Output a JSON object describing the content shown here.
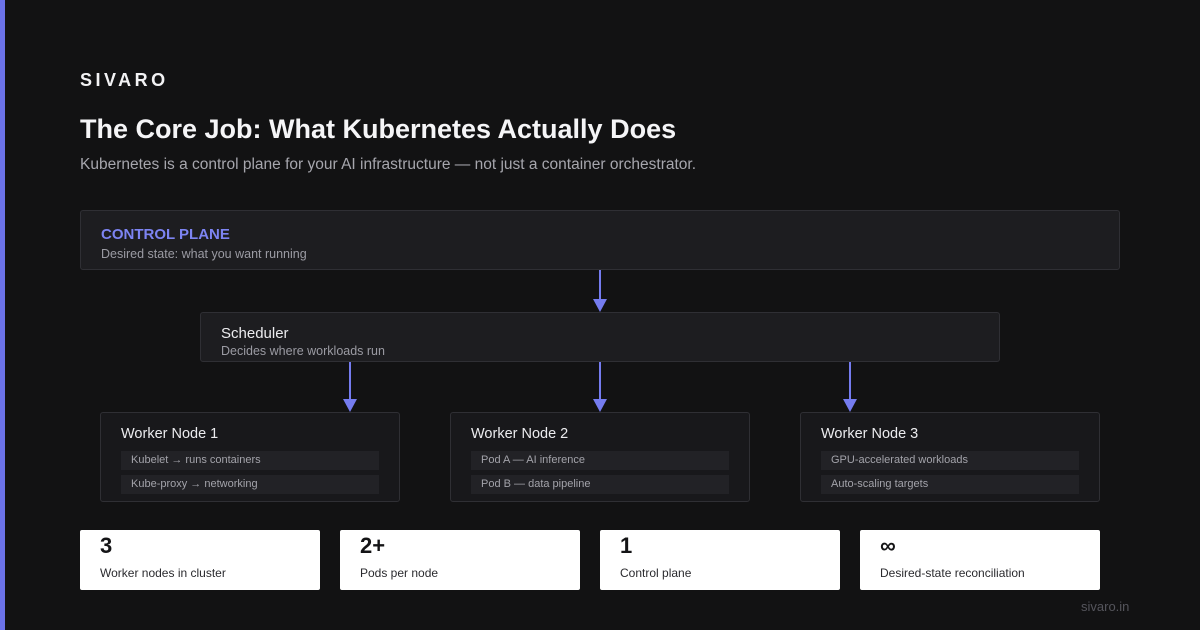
{
  "brand": "SIVARO",
  "title": "The Core Job: What Kubernetes Actually Does",
  "subtitle": "Kubernetes is a control plane for your AI infrastructure — not just a container orchestrator.",
  "control_plane": {
    "title": "CONTROL PLANE",
    "description": "Desired state: what you want running"
  },
  "scheduler": {
    "title": "Scheduler",
    "description": "Decides where workloads run"
  },
  "workers": [
    {
      "title": "Worker Node 1",
      "items": [
        "Kubelet → runs containers",
        "Kube-proxy → networking"
      ]
    },
    {
      "title": "Worker Node 2",
      "items": [
        "Pod A — AI inference",
        "Pod B — data pipeline"
      ]
    },
    {
      "title": "Worker Node 3",
      "items": [
        "GPU-accelerated workloads",
        "Auto-scaling targets"
      ]
    }
  ],
  "stats": [
    {
      "value": "3",
      "label": "Worker nodes in cluster"
    },
    {
      "value": "2+",
      "label": "Pods per node"
    },
    {
      "value": "1",
      "label": "Control plane"
    },
    {
      "value": "∞",
      "label": "Desired-state reconciliation"
    }
  ],
  "footer": "sivaro.in",
  "colors": {
    "background": "#121213",
    "accent": "#6b72e8",
    "arrow": "#757cf0",
    "control_plane_title": "#7d84f2"
  }
}
